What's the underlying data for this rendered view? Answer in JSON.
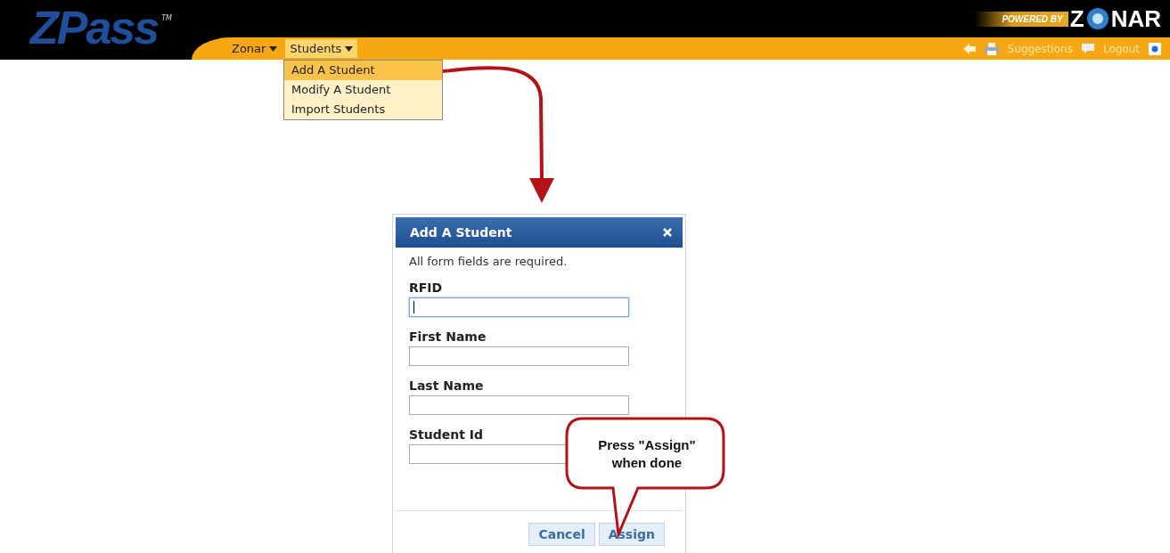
{
  "header": {
    "logo": {
      "text": "ZPass",
      "mark": "TM"
    },
    "brand": {
      "prefix": "POWERED BY",
      "name_start": "Z",
      "name_end": "NAR"
    },
    "nav": [
      {
        "label": "Zonar",
        "expanded": false
      },
      {
        "label": "Students",
        "expanded": true
      }
    ],
    "tools": {
      "suggestions": "Suggestions",
      "logout": "Logout"
    }
  },
  "dropdown": [
    {
      "label": "Add A Student",
      "selected": true
    },
    {
      "label": "Modify A Student",
      "selected": false
    },
    {
      "label": "Import Students",
      "selected": false
    }
  ],
  "dialog": {
    "title": "Add A Student",
    "note": "All form fields are required.",
    "fields": [
      {
        "label": "RFID",
        "focused": true
      },
      {
        "label": "First Name",
        "focused": false
      },
      {
        "label": "Last Name",
        "focused": false
      },
      {
        "label": "Student Id",
        "focused": false
      }
    ],
    "buttons": [
      "Cancel",
      "Assign"
    ]
  },
  "callout": {
    "lines": [
      "Press \"Assign\"",
      "when done"
    ]
  }
}
